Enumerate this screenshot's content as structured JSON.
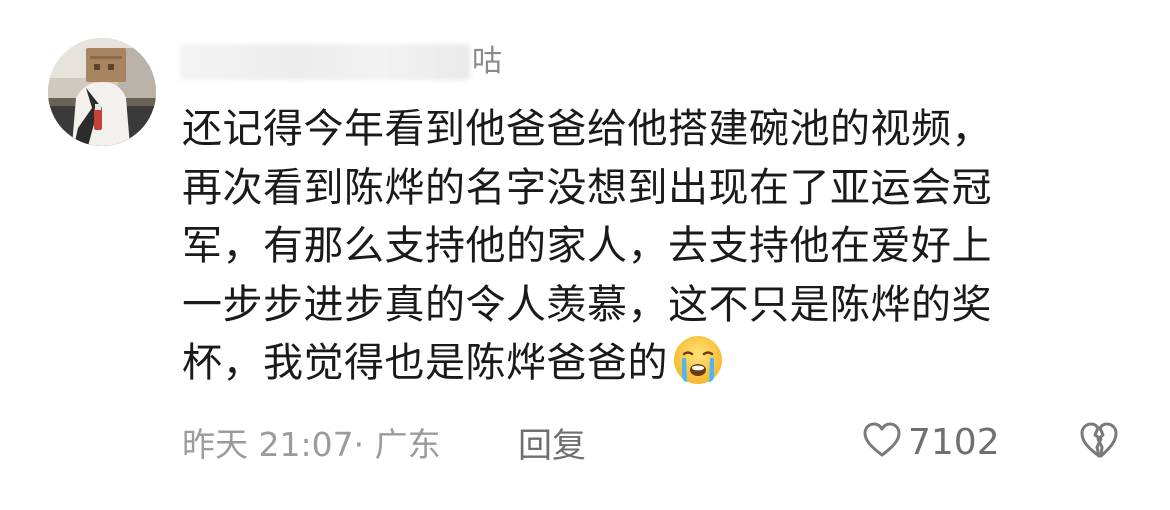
{
  "comment": {
    "username_suffix": "咕",
    "lines": [
      "还记得今年看到他爸爸给他搭建碗池的视频，",
      "再次看到陈烨的名字没想到出现在了亚运会冠",
      "军，有那么支持他的家人，去支持他在爱好上",
      "一步步进步真的令人羡慕，这不只是陈烨的奖",
      "杯，我觉得也是陈烨爸爸的"
    ],
    "emoji": "crying-face-emoji",
    "time": "昨天 21:07",
    "location": "· 广东",
    "reply_label": "回复",
    "like_count": "7102",
    "icons": {
      "like": "heart-outline-icon",
      "dislike": "broken-heart-icon"
    },
    "colors": {
      "text": "#1a1a1a",
      "meta": "#9b9b9b",
      "action": "#6f6f6f"
    }
  }
}
